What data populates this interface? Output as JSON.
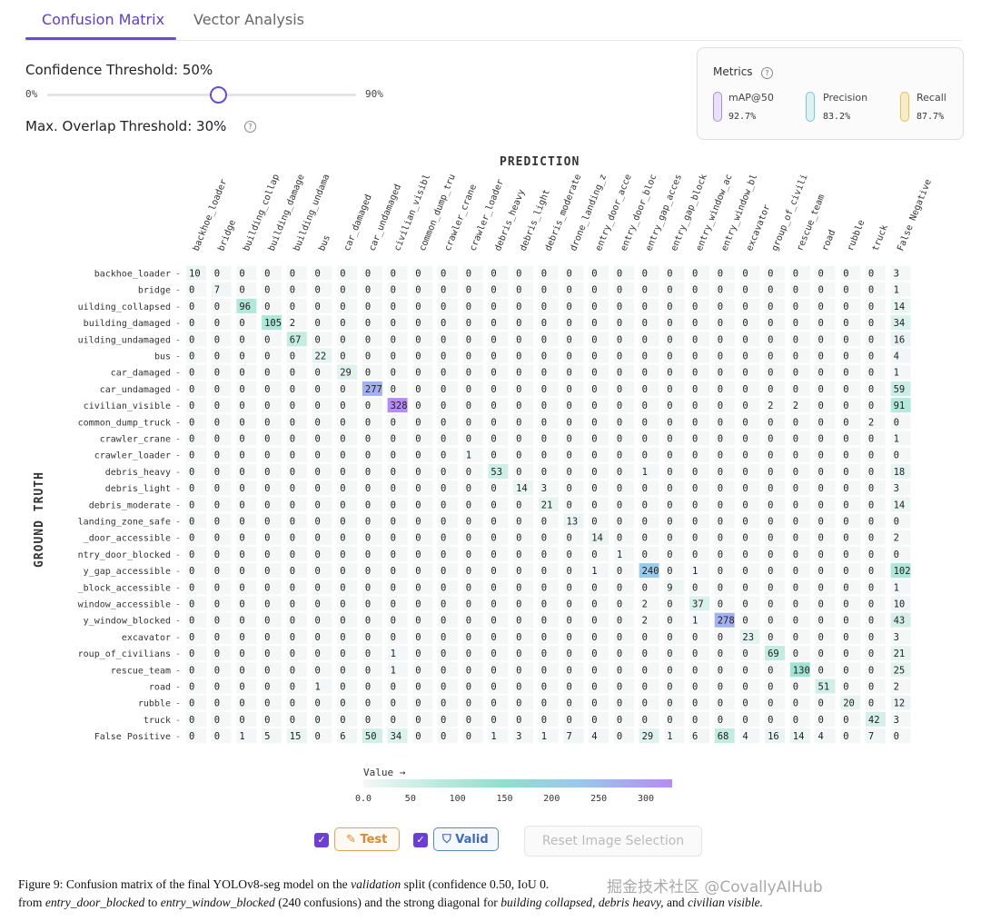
{
  "tabs": [
    {
      "label": "Confusion Matrix",
      "active": true
    },
    {
      "label": "Vector Analysis",
      "active": false
    }
  ],
  "controls": {
    "confidence_label": "Confidence Threshold: 50%",
    "confidence_value": 0.5,
    "slider_min": "0%",
    "slider_max": "90%",
    "overlap_label": "Max. Overlap Threshold: 30%"
  },
  "metrics": {
    "title": "Metrics",
    "items": [
      {
        "label": "mAP@50",
        "value": "92.7%",
        "fill": 0.927,
        "color": "#a98ce6"
      },
      {
        "label": "Precision",
        "value": "83.2%",
        "fill": 0.832,
        "color": "#7ec7d6"
      },
      {
        "label": "Recall",
        "value": "87.7%",
        "fill": 0.877,
        "color": "#e6c15a"
      }
    ]
  },
  "chart_data": {
    "type": "heatmap",
    "xlabel": "PREDICTION",
    "ylabel": "GROUND TRUTH",
    "col_labels": [
      "backhoe_loader",
      "bridge",
      "building_collap",
      "building_damage",
      "building_undama",
      "bus",
      "car_damaged",
      "car_undamaged",
      "civilian_visibl",
      "common_dump_tru",
      "crawler_crane",
      "crawler_loader",
      "debris_heavy",
      "debris_light",
      "debris_moderate",
      "drone_landing_z",
      "entry_door_acce",
      "entry_door_bloc",
      "entry_gap_acces",
      "entry_gap_block",
      "entry_window_ac",
      "entry_window_bl",
      "excavator",
      "group_of_civili",
      "rescue_team",
      "road",
      "rubble",
      "truck",
      "False Negative"
    ],
    "row_labels": [
      "backhoe_loader",
      "bridge",
      "uilding_collapsed",
      "building_damaged",
      "uilding_undamaged",
      "bus",
      "car_damaged",
      "car_undamaged",
      "civilian_visible",
      "common_dump_truck",
      "crawler_crane",
      "crawler_loader",
      "debris_heavy",
      "debris_light",
      "debris_moderate",
      "landing_zone_safe",
      "_door_accessible",
      "ntry_door_blocked",
      "y_gap_accessible",
      "_block_accessible",
      "window_accessible",
      "y_window_blocked",
      "excavator",
      "roup_of_civilians",
      "rescue_team",
      "road",
      "rubble",
      "truck",
      "False Positive"
    ],
    "matrix": [
      [
        10,
        0,
        0,
        0,
        0,
        0,
        0,
        0,
        0,
        0,
        0,
        0,
        0,
        0,
        0,
        0,
        0,
        0,
        0,
        0,
        0,
        0,
        0,
        0,
        0,
        0,
        0,
        0,
        3
      ],
      [
        0,
        7,
        0,
        0,
        0,
        0,
        0,
        0,
        0,
        0,
        0,
        0,
        0,
        0,
        0,
        0,
        0,
        0,
        0,
        0,
        0,
        0,
        0,
        0,
        0,
        0,
        0,
        0,
        1
      ],
      [
        0,
        0,
        96,
        0,
        0,
        0,
        0,
        0,
        0,
        0,
        0,
        0,
        0,
        0,
        0,
        0,
        0,
        0,
        0,
        0,
        0,
        0,
        0,
        0,
        0,
        0,
        0,
        0,
        14
      ],
      [
        0,
        0,
        0,
        105,
        2,
        0,
        0,
        0,
        0,
        0,
        0,
        0,
        0,
        0,
        0,
        0,
        0,
        0,
        0,
        0,
        0,
        0,
        0,
        0,
        0,
        0,
        0,
        0,
        34
      ],
      [
        0,
        0,
        0,
        0,
        67,
        0,
        0,
        0,
        0,
        0,
        0,
        0,
        0,
        0,
        0,
        0,
        0,
        0,
        0,
        0,
        0,
        0,
        0,
        0,
        0,
        0,
        0,
        0,
        16
      ],
      [
        0,
        0,
        0,
        0,
        0,
        22,
        0,
        0,
        0,
        0,
        0,
        0,
        0,
        0,
        0,
        0,
        0,
        0,
        0,
        0,
        0,
        0,
        0,
        0,
        0,
        0,
        0,
        0,
        4
      ],
      [
        0,
        0,
        0,
        0,
        0,
        0,
        29,
        0,
        0,
        0,
        0,
        0,
        0,
        0,
        0,
        0,
        0,
        0,
        0,
        0,
        0,
        0,
        0,
        0,
        0,
        0,
        0,
        0,
        1
      ],
      [
        0,
        0,
        0,
        0,
        0,
        0,
        0,
        277,
        0,
        0,
        0,
        0,
        0,
        0,
        0,
        0,
        0,
        0,
        0,
        0,
        0,
        0,
        0,
        0,
        0,
        0,
        0,
        0,
        59
      ],
      [
        0,
        0,
        0,
        0,
        0,
        0,
        0,
        0,
        328,
        0,
        0,
        0,
        0,
        0,
        0,
        0,
        0,
        0,
        0,
        0,
        0,
        0,
        0,
        2,
        2,
        0,
        0,
        0,
        91
      ],
      [
        0,
        0,
        0,
        0,
        0,
        0,
        0,
        0,
        0,
        0,
        0,
        0,
        0,
        0,
        0,
        0,
        0,
        0,
        0,
        0,
        0,
        0,
        0,
        0,
        0,
        0,
        0,
        2,
        0
      ],
      [
        0,
        0,
        0,
        0,
        0,
        0,
        0,
        0,
        0,
        0,
        0,
        0,
        0,
        0,
        0,
        0,
        0,
        0,
        0,
        0,
        0,
        0,
        0,
        0,
        0,
        0,
        0,
        0,
        1
      ],
      [
        0,
        0,
        0,
        0,
        0,
        0,
        0,
        0,
        0,
        0,
        0,
        1,
        0,
        0,
        0,
        0,
        0,
        0,
        0,
        0,
        0,
        0,
        0,
        0,
        0,
        0,
        0,
        0,
        0
      ],
      [
        0,
        0,
        0,
        0,
        0,
        0,
        0,
        0,
        0,
        0,
        0,
        0,
        53,
        0,
        0,
        0,
        0,
        0,
        1,
        0,
        0,
        0,
        0,
        0,
        0,
        0,
        0,
        0,
        18
      ],
      [
        0,
        0,
        0,
        0,
        0,
        0,
        0,
        0,
        0,
        0,
        0,
        0,
        0,
        14,
        3,
        0,
        0,
        0,
        0,
        0,
        0,
        0,
        0,
        0,
        0,
        0,
        0,
        0,
        3
      ],
      [
        0,
        0,
        0,
        0,
        0,
        0,
        0,
        0,
        0,
        0,
        0,
        0,
        0,
        0,
        21,
        0,
        0,
        0,
        0,
        0,
        0,
        0,
        0,
        0,
        0,
        0,
        0,
        0,
        14
      ],
      [
        0,
        0,
        0,
        0,
        0,
        0,
        0,
        0,
        0,
        0,
        0,
        0,
        0,
        0,
        0,
        13,
        0,
        0,
        0,
        0,
        0,
        0,
        0,
        0,
        0,
        0,
        0,
        0,
        0
      ],
      [
        0,
        0,
        0,
        0,
        0,
        0,
        0,
        0,
        0,
        0,
        0,
        0,
        0,
        0,
        0,
        0,
        14,
        0,
        0,
        0,
        0,
        0,
        0,
        0,
        0,
        0,
        0,
        0,
        2
      ],
      [
        0,
        0,
        0,
        0,
        0,
        0,
        0,
        0,
        0,
        0,
        0,
        0,
        0,
        0,
        0,
        0,
        0,
        1,
        0,
        0,
        0,
        0,
        0,
        0,
        0,
        0,
        0,
        0,
        0
      ],
      [
        0,
        0,
        0,
        0,
        0,
        0,
        0,
        0,
        0,
        0,
        0,
        0,
        0,
        0,
        0,
        0,
        1,
        0,
        240,
        0,
        1,
        0,
        0,
        0,
        0,
        0,
        0,
        0,
        102
      ],
      [
        0,
        0,
        0,
        0,
        0,
        0,
        0,
        0,
        0,
        0,
        0,
        0,
        0,
        0,
        0,
        0,
        0,
        0,
        0,
        9,
        0,
        0,
        0,
        0,
        0,
        0,
        0,
        0,
        1
      ],
      [
        0,
        0,
        0,
        0,
        0,
        0,
        0,
        0,
        0,
        0,
        0,
        0,
        0,
        0,
        0,
        0,
        0,
        0,
        2,
        0,
        37,
        0,
        0,
        0,
        0,
        0,
        0,
        0,
        10
      ],
      [
        0,
        0,
        0,
        0,
        0,
        0,
        0,
        0,
        0,
        0,
        0,
        0,
        0,
        0,
        0,
        0,
        0,
        0,
        2,
        0,
        1,
        278,
        0,
        0,
        0,
        0,
        0,
        0,
        43
      ],
      [
        0,
        0,
        0,
        0,
        0,
        0,
        0,
        0,
        0,
        0,
        0,
        0,
        0,
        0,
        0,
        0,
        0,
        0,
        0,
        0,
        0,
        0,
        23,
        0,
        0,
        0,
        0,
        0,
        3
      ],
      [
        0,
        0,
        0,
        0,
        0,
        0,
        0,
        0,
        1,
        0,
        0,
        0,
        0,
        0,
        0,
        0,
        0,
        0,
        0,
        0,
        0,
        0,
        0,
        69,
        0,
        0,
        0,
        0,
        21
      ],
      [
        0,
        0,
        0,
        0,
        0,
        0,
        0,
        0,
        1,
        0,
        0,
        0,
        0,
        0,
        0,
        0,
        0,
        0,
        0,
        0,
        0,
        0,
        0,
        0,
        130,
        0,
        0,
        0,
        25
      ],
      [
        0,
        0,
        0,
        0,
        0,
        1,
        0,
        0,
        0,
        0,
        0,
        0,
        0,
        0,
        0,
        0,
        0,
        0,
        0,
        0,
        0,
        0,
        0,
        0,
        0,
        51,
        0,
        0,
        2
      ],
      [
        0,
        0,
        0,
        0,
        0,
        0,
        0,
        0,
        0,
        0,
        0,
        0,
        0,
        0,
        0,
        0,
        0,
        0,
        0,
        0,
        0,
        0,
        0,
        0,
        0,
        0,
        20,
        0,
        12
      ],
      [
        0,
        0,
        0,
        0,
        0,
        0,
        0,
        0,
        0,
        0,
        0,
        0,
        0,
        0,
        0,
        0,
        0,
        0,
        0,
        0,
        0,
        0,
        0,
        0,
        0,
        0,
        0,
        42,
        3
      ],
      [
        0,
        0,
        1,
        5,
        15,
        0,
        6,
        50,
        34,
        0,
        0,
        0,
        1,
        3,
        1,
        7,
        4,
        0,
        29,
        1,
        6,
        68,
        4,
        16,
        14,
        4,
        0,
        7,
        0
      ]
    ],
    "colorbar": {
      "title": "Value →",
      "range": [
        0,
        328
      ],
      "ticks": [
        "0.0",
        "50",
        "100",
        "150",
        "200",
        "250",
        "300"
      ],
      "tick_values": [
        0,
        50,
        100,
        150,
        200,
        250,
        300
      ],
      "colors": [
        "#f5f7f7",
        "#b9eadc",
        "#8fe0cc",
        "#98c8ef",
        "#b68cf2"
      ]
    }
  },
  "toggles": {
    "test_label": "Test",
    "valid_label": "Valid",
    "reset_label": "Reset Image Selection"
  },
  "caption": {
    "prefix": "Figure 9:  Confusion matrix of the final YOLOv8-seg model on the ",
    "em1": "validation",
    "mid1": " split (confidence 0.50, IoU 0.",
    "line2_pre": "from ",
    "em2": "entry_door_blocked",
    "line2_mid": " to ",
    "em3": "entry_window_blocked",
    "line2_mid2": " (240 confusions) and the strong diagonal for ",
    "em4": "building collapsed, debris heavy,",
    "line2_and": " and ",
    "em5": "civilian visible.",
    "watermark": "掘金技术社区 @CovallyAIHub"
  }
}
